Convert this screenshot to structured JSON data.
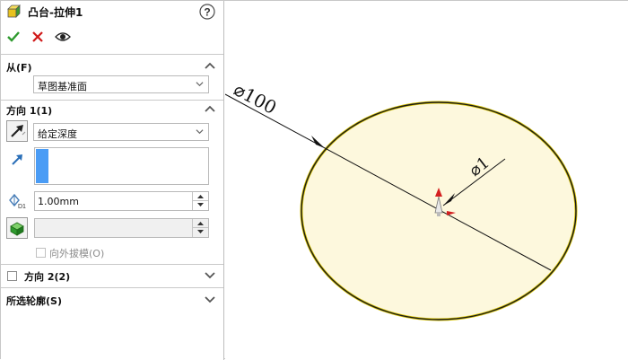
{
  "feature": {
    "title": "凸台-拉伸1",
    "help_icon": "help-icon",
    "ok_icon": "checkmark-icon",
    "cancel_icon": "close-icon",
    "preview_icon": "eye-icon"
  },
  "from": {
    "title": "从(F)",
    "selected": "草图基准面"
  },
  "direction1": {
    "title": "方向 1(1)",
    "end_condition": "给定深度",
    "depth": "1.00mm",
    "draft_outward_label": "向外拔模(O)",
    "draft_outward_checked": false
  },
  "direction2": {
    "title": "方向 2(2)",
    "checked": false
  },
  "selected_contours": {
    "title": "所选轮廓(S)"
  },
  "sketch": {
    "diameter_label": "⌀100",
    "depth_label": "⌀1",
    "fill_color": "#fdf8dd",
    "edge_color": "#1a1a1a",
    "rim_color": "#d8c400"
  },
  "colors": {
    "accent_blue": "#4a9cf5",
    "green_icon": "#3a9a2e",
    "red_x": "#d01818"
  }
}
